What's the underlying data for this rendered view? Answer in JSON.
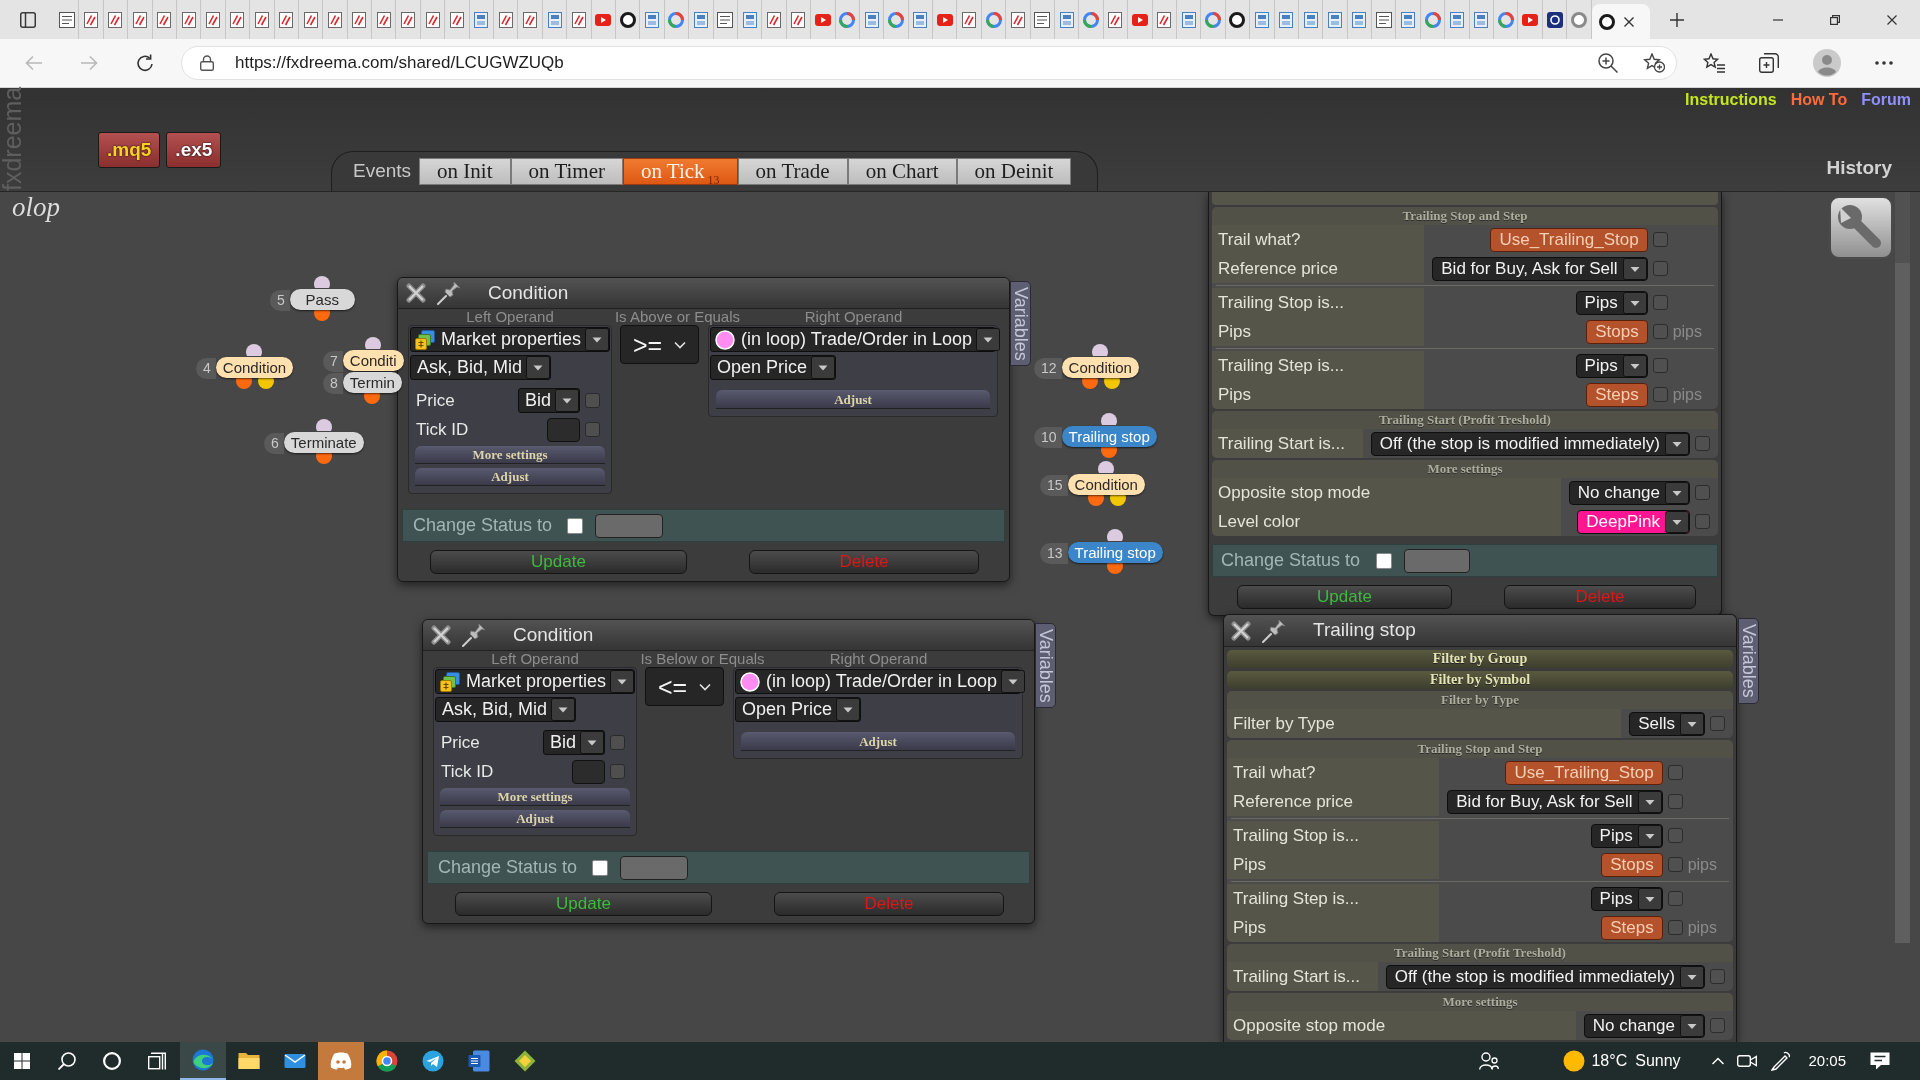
{
  "browser": {
    "tabs": [
      {
        "selected": false
      },
      {
        "selected": false
      },
      {
        "selected": false
      },
      {
        "selected": false
      },
      {
        "selected": false
      },
      {
        "selected": false
      },
      {
        "selected": false
      },
      {
        "selected": false
      },
      {
        "selected": false
      },
      {
        "selected": false
      },
      {
        "selected": false
      },
      {
        "selected": false
      },
      {
        "selected": false
      },
      {
        "selected": false
      },
      {
        "selected": false
      },
      {
        "selected": false
      },
      {
        "selected": false
      },
      {
        "selected": false
      },
      {
        "selected": false
      },
      {
        "selected": false
      },
      {
        "selected": false
      },
      {
        "selected": false
      },
      {
        "selected": false
      },
      {
        "selected": false
      },
      {
        "selected": false
      },
      {
        "selected": false
      },
      {
        "selected": false
      },
      {
        "selected": false
      },
      {
        "selected": false
      },
      {
        "selected": false
      },
      {
        "selected": false
      },
      {
        "selected": false
      },
      {
        "selected": false
      },
      {
        "selected": false
      },
      {
        "selected": false
      },
      {
        "selected": false
      },
      {
        "selected": false
      },
      {
        "selected": false
      },
      {
        "selected": false
      },
      {
        "selected": false
      },
      {
        "selected": false
      },
      {
        "selected": false
      },
      {
        "selected": false
      },
      {
        "selected": false
      },
      {
        "selected": false
      },
      {
        "selected": false
      },
      {
        "selected": false
      },
      {
        "selected": false
      },
      {
        "selected": false
      },
      {
        "selected": false
      },
      {
        "selected": false
      },
      {
        "selected": false
      },
      {
        "selected": false
      },
      {
        "selected": false
      },
      {
        "selected": false
      },
      {
        "selected": false
      },
      {
        "selected": false
      },
      {
        "selected": false
      },
      {
        "selected": false
      },
      {
        "selected": false
      },
      {
        "selected": false
      },
      {
        "selected": false
      },
      {
        "selected": false
      },
      {
        "selected": true
      }
    ],
    "back": {
      "disabled": true
    },
    "forward": {
      "disabled": true
    },
    "url": "https://fxdreema.com/shared/LCUGWZUQb"
  },
  "header": {
    "side_label": "fxdreema",
    "export_buttons": [
      {
        "label": ".mq5",
        "kind": "source"
      },
      {
        "label": ".ex5",
        "kind": "compiled"
      }
    ],
    "events": {
      "label": "Events",
      "tabs": [
        {
          "label": "on Init",
          "selected": false
        },
        {
          "label": "on Timer",
          "selected": false
        },
        {
          "label": "on Tick",
          "selected": true,
          "count": "13"
        },
        {
          "label": "on Trade",
          "selected": false
        },
        {
          "label": "on Chart",
          "selected": false
        },
        {
          "label": "on Deinit",
          "selected": false
        }
      ]
    },
    "links": [
      {
        "label": "Instructions",
        "color": "#c5e51c"
      },
      {
        "label": "How To",
        "color": "#ff6b3d"
      },
      {
        "label": "Forum",
        "color": "#8f8fff"
      }
    ],
    "history": "History"
  },
  "canvas": {
    "project_name": "olop",
    "nodes": [
      {
        "number": "5",
        "label": "Pass",
        "kind": "pass"
      },
      {
        "number": "4",
        "label": "Condition",
        "kind": "condition"
      },
      {
        "number": "7",
        "label": "Conditi",
        "kind": "condition"
      },
      {
        "number": "8",
        "label": "Termin",
        "kind": "terminate"
      },
      {
        "number": "6",
        "label": "Terminate",
        "kind": "terminate"
      },
      {
        "number": "12",
        "label": "Condition",
        "kind": "condition"
      },
      {
        "number": "10",
        "label": "Trailing stop",
        "kind": "trailing_stop"
      },
      {
        "number": "15",
        "label": "Condition",
        "kind": "condition"
      },
      {
        "number": "13",
        "label": "Trailing stop",
        "kind": "trailing_stop"
      }
    ],
    "condition_panels": [
      {
        "title": "Condition",
        "variables_tab": "Variables",
        "left": {
          "heading": "Left Operand",
          "source": "Market properties",
          "property": "Ask, Bid, Mid",
          "fields": [
            {
              "label": "Price",
              "kind": "dropdown",
              "value": "Bid",
              "checked": false
            },
            {
              "label": "Tick ID",
              "kind": "input",
              "checked": false
            }
          ],
          "buttons": [
            "More settings",
            "Adjust"
          ]
        },
        "operator": {
          "heading": "Is Above or Equals",
          "value": ">="
        },
        "right": {
          "heading": "Right Operand",
          "source": "(in loop) Trade/Order in Loop",
          "property": "Open Price",
          "buttons": [
            "Adjust"
          ]
        },
        "change_status": {
          "label": "Change Status to",
          "checked": false
        },
        "actions": [
          {
            "label": "Update",
            "kind": "update"
          },
          {
            "label": "Delete",
            "kind": "delete"
          }
        ]
      },
      {
        "title": "Condition",
        "variables_tab": "Variables",
        "left": {
          "heading": "Left Operand",
          "source": "Market properties",
          "property": "Ask, Bid, Mid",
          "fields": [
            {
              "label": "Price",
              "kind": "dropdown",
              "value": "Bid",
              "checked": false
            },
            {
              "label": "Tick ID",
              "kind": "input",
              "checked": false
            }
          ],
          "buttons": [
            "More settings",
            "Adjust"
          ]
        },
        "operator": {
          "heading": "Is Below or Equals",
          "value": "<="
        },
        "right": {
          "heading": "Right Operand",
          "source": "(in loop) Trade/Order in Loop",
          "property": "Open Price",
          "buttons": [
            "Adjust"
          ]
        },
        "change_status": {
          "label": "Change Status to",
          "checked": false
        },
        "actions": [
          {
            "label": "Update",
            "kind": "update"
          },
          {
            "label": "Delete",
            "kind": "delete"
          }
        ]
      }
    ],
    "trailing_panels": [
      {
        "sections": [
          {
            "kind": "open",
            "title": "Trailing Stop and Step",
            "groups": [
              [
                {
                  "label": "Trail what?",
                  "kind": "value",
                  "value": "Use_Trailing_Stop",
                  "checked": false
                },
                {
                  "label": "Reference price",
                  "kind": "dropdown",
                  "value": "Bid for Buy, Ask for Sell",
                  "checked": false
                }
              ],
              [
                {
                  "label": "Trailing Stop is...",
                  "kind": "dropdown",
                  "value": "Pips",
                  "checked": false
                },
                {
                  "label": "Pips",
                  "kind": "value",
                  "value": "Stops",
                  "unit": "pips",
                  "checked": false
                }
              ],
              [
                {
                  "label": "Trailing Step is...",
                  "kind": "dropdown",
                  "value": "Pips",
                  "checked": false
                },
                {
                  "label": "Pips",
                  "kind": "value",
                  "value": "Steps",
                  "unit": "pips",
                  "checked": false
                }
              ]
            ]
          },
          {
            "kind": "open",
            "title": "Trailing Start (Profit Treshold)",
            "groups": [
              [
                {
                  "label": "Trailing Start is...",
                  "kind": "dropdown",
                  "value": "Off (the stop is modified immediately)",
                  "checked": false
                }
              ]
            ]
          },
          {
            "kind": "open",
            "title": "More settings",
            "groups": [
              [
                {
                  "label": "Opposite stop mode",
                  "kind": "dropdown",
                  "value": "No change",
                  "checked": false
                },
                {
                  "label": "Level color",
                  "kind": "color",
                  "value": "DeepPink",
                  "color": "#ff1493",
                  "checked": false
                }
              ]
            ]
          }
        ],
        "change_status": {
          "label": "Change Status to",
          "checked": false
        },
        "actions": [
          {
            "label": "Update",
            "kind": "update"
          },
          {
            "label": "Delete",
            "kind": "delete"
          }
        ]
      },
      {
        "title": "Trailing stop",
        "variables_tab": "Variables",
        "sections": [
          {
            "kind": "collapsed",
            "title": "Filter by Group"
          },
          {
            "kind": "collapsed",
            "title": "Filter by Symbol"
          },
          {
            "kind": "open",
            "title": "Filter by Type",
            "groups": [
              [
                {
                  "label": "Filter by Type",
                  "kind": "dropdown",
                  "value": "Sells",
                  "checked": false
                }
              ]
            ]
          },
          {
            "kind": "open",
            "title": "Trailing Stop and Step",
            "groups": [
              [
                {
                  "label": "Trail what?",
                  "kind": "value",
                  "value": "Use_Trailing_Stop",
                  "checked": false
                },
                {
                  "label": "Reference price",
                  "kind": "dropdown",
                  "value": "Bid for Buy, Ask for Sell",
                  "checked": false
                }
              ],
              [
                {
                  "label": "Trailing Stop is...",
                  "kind": "dropdown",
                  "value": "Pips",
                  "checked": false
                },
                {
                  "label": "Pips",
                  "kind": "value",
                  "value": "Stops",
                  "unit": "pips",
                  "checked": false
                }
              ],
              [
                {
                  "label": "Trailing Step is...",
                  "kind": "dropdown",
                  "value": "Pips",
                  "checked": false
                },
                {
                  "label": "Pips",
                  "kind": "value",
                  "value": "Steps",
                  "unit": "pips",
                  "checked": false
                }
              ]
            ]
          },
          {
            "kind": "open",
            "title": "Trailing Start (Profit Treshold)",
            "groups": [
              [
                {
                  "label": "Trailing Start is...",
                  "kind": "dropdown",
                  "value": "Off (the stop is modified immediately)",
                  "checked": false
                }
              ]
            ]
          },
          {
            "kind": "open",
            "title": "More settings",
            "groups": [
              [
                {
                  "label": "Opposite stop mode",
                  "kind": "dropdown",
                  "value": "No change",
                  "checked": false
                }
              ]
            ]
          }
        ]
      }
    ]
  },
  "taskbar": {
    "apps": [
      {
        "selected": true,
        "flashing": false
      },
      {
        "selected": false,
        "flashing": false
      },
      {
        "selected": false,
        "flashing": false
      },
      {
        "selected": false,
        "flashing": true
      },
      {
        "selected": false,
        "flashing": false
      },
      {
        "selected": false,
        "flashing": false
      },
      {
        "selected": false,
        "flashing": false
      },
      {
        "selected": false,
        "flashing": false
      }
    ],
    "weather": {
      "temperature": "18°C",
      "condition": "Sunny"
    },
    "clock": "20:05"
  }
}
